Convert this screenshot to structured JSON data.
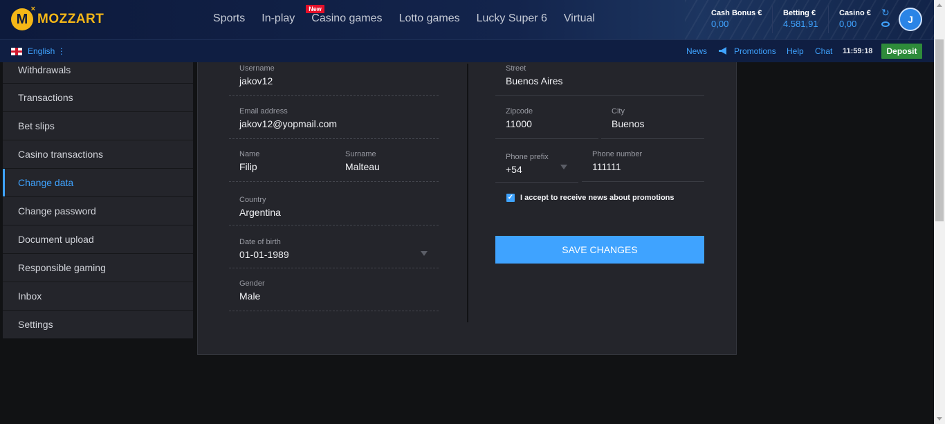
{
  "header": {
    "brand": "MOZZART",
    "nav": [
      {
        "label": "Sports"
      },
      {
        "label": "In-play"
      },
      {
        "label": "Casino games",
        "badge": "New"
      },
      {
        "label": "Lotto games"
      },
      {
        "label": "Lucky Super 6"
      },
      {
        "label": "Virtual"
      }
    ],
    "balances": [
      {
        "label": "Cash Bonus €",
        "value": "0,00"
      },
      {
        "label": "Betting €",
        "value": "4.581,91"
      },
      {
        "label": "Casino €",
        "value": "0,00"
      }
    ],
    "avatar_initial": "J"
  },
  "subbar": {
    "language": "English ⋮",
    "links": {
      "news": "News",
      "promotions": "Promotions",
      "help": "Help",
      "chat": "Chat"
    },
    "clock": "11:59:18",
    "deposit": "Deposit"
  },
  "sidebar": {
    "items": [
      {
        "label": "Withdrawals"
      },
      {
        "label": "Transactions"
      },
      {
        "label": "Bet slips"
      },
      {
        "label": "Casino transactions"
      },
      {
        "label": "Change data",
        "active": true
      },
      {
        "label": "Change password"
      },
      {
        "label": "Document upload"
      },
      {
        "label": "Responsible gaming"
      },
      {
        "label": "Inbox"
      },
      {
        "label": "Settings"
      }
    ]
  },
  "form": {
    "username": {
      "label": "Username",
      "value": "jakov12"
    },
    "email": {
      "label": "Email address",
      "value": "jakov12@yopmail.com"
    },
    "name": {
      "label": "Name",
      "value": "Filip"
    },
    "surname": {
      "label": "Surname",
      "value": "Malteau"
    },
    "country": {
      "label": "Country",
      "value": "Argentina"
    },
    "dob": {
      "label": "Date of birth",
      "value": "01-01-1989"
    },
    "gender": {
      "label": "Gender",
      "value": "Male"
    },
    "street": {
      "label": "Street",
      "value": "Buenos Aires"
    },
    "zipcode": {
      "label": "Zipcode",
      "value": "11000"
    },
    "city": {
      "label": "City",
      "value": "Buenos"
    },
    "phone_prefix": {
      "label": "Phone prefix",
      "value": "+54"
    },
    "phone_number": {
      "label": "Phone number",
      "value": "111111"
    },
    "promo_checkbox": {
      "label": "I accept to receive news about promotions",
      "checked": true
    },
    "save_label": "SAVE CHANGES"
  },
  "colors": {
    "accent": "#3fa3ff",
    "brand": "#f5b717",
    "deposit": "#2e8b3a",
    "badge": "#e4102a"
  }
}
